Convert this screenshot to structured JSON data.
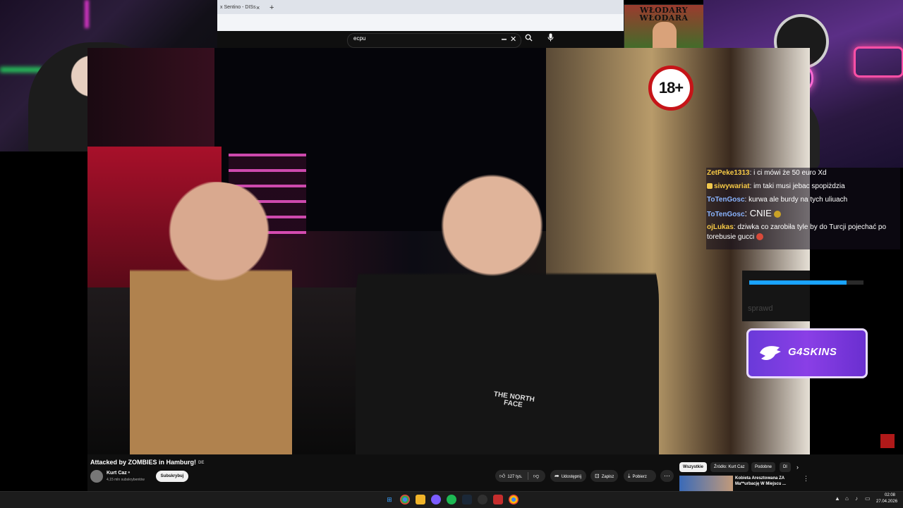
{
  "browser": {
    "tab_title": "x Sentino - DISs",
    "tab_close": "×",
    "new_tab": "+"
  },
  "youtube": {
    "search": {
      "value": "ecpu",
      "kbd_icon": "keyboard-icon",
      "clear": "✕"
    },
    "search_button_icon": "search-icon",
    "mic_icon": "mic-icon"
  },
  "poster": {
    "title": "WŁODARY WŁODARA"
  },
  "video": {
    "age_badge": "18+",
    "shirt_brand": "THE NORTH FACE"
  },
  "chat": {
    "messages": [
      {
        "user": "ZetPeke1313",
        "user_color": "#f6c945",
        "text": ": i ci mówi że 50 euro Xd",
        "badge": false,
        "emote": ""
      },
      {
        "user": "siwywariat",
        "user_color": "#f6c945",
        "text": ": im taki musi jebac spopiżdzia",
        "badge": true,
        "emote": ""
      },
      {
        "user": "ToTenGosc",
        "user_color": "#8ab4ff",
        "text": ": kurwa ale burdy na tych uliuach",
        "badge": false,
        "emote": ""
      },
      {
        "user": "ToTenGosc",
        "user_color": "#8ab4ff",
        "text": ": CNIE",
        "badge": false,
        "emote": "sun"
      },
      {
        "user": "ojLukas",
        "user_color": "#f6c945",
        "text": ": dziwka co zarobiła tyle by do Turcji pojechać po torebusie gucci",
        "badge": false,
        "emote": "red"
      }
    ]
  },
  "widget": {
    "label": "sprawd",
    "progress": 0.85,
    "progress_color": "#1aa3ff"
  },
  "sponsor": {
    "name": "G4SKINS"
  },
  "info": {
    "title": "Attacked by ZOMBIES in Hamburg!",
    "lang": "DE",
    "channel": "Kurt Caz",
    "subs": "4,15 mln subskrybentów",
    "subscribe": "Subskrybuj",
    "likes": "127 tys.",
    "share": "Udostępnij",
    "save": "Zapisz",
    "download": "Pobierz",
    "more": "⋯"
  },
  "related": {
    "chips": [
      {
        "label": "Wszystkie",
        "active": true
      },
      {
        "label": "Źródło: Kurt Caz",
        "active": false
      },
      {
        "label": "Podobne",
        "active": false
      },
      {
        "label": "Dl",
        "active": false
      }
    ],
    "video_title": "Kobieta Aresztowana ZA Ma**urbację W Miejscu ..."
  },
  "taskbar": {
    "icons": [
      "windows-icon",
      "chrome-icon",
      "file-explorer-icon",
      "messenger-icon",
      "spotify-icon",
      "steam-icon",
      "obs-icon",
      "terminal-icon",
      "chrome-alt-icon",
      "chrome-profile-icon"
    ],
    "time": "02:08",
    "date": "27.04.2026"
  },
  "colors": {
    "accent_purple": "#8a3fe6",
    "badge_red": "#c61418",
    "youtube_bg": "#0f0f0f"
  }
}
